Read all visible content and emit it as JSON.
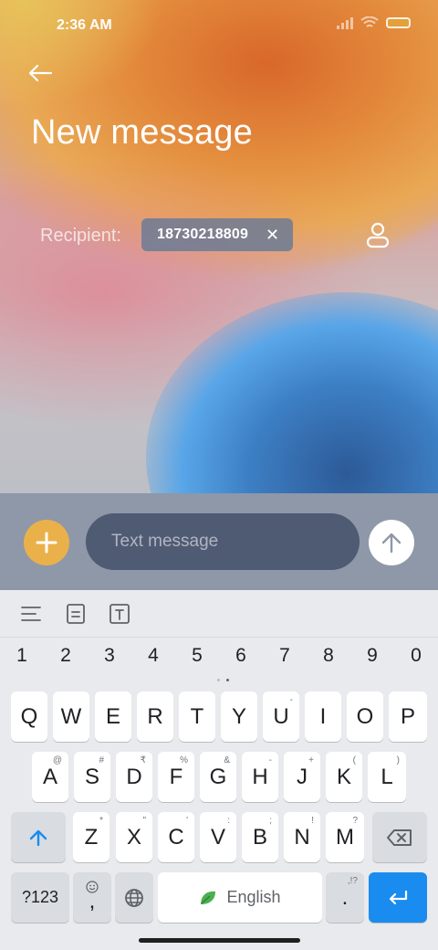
{
  "status_bar": {
    "time": "2:36 AM",
    "icons": [
      "signal-icon",
      "wifi-icon",
      "battery-icon"
    ],
    "battery_color": "#e4a03a"
  },
  "header": {
    "back_icon": "back-arrow-icon",
    "title": "New message"
  },
  "recipient": {
    "label": "Recipient:",
    "chips": [
      {
        "number": "18730218809",
        "remove_icon": "close-icon"
      }
    ],
    "contact_icon": "contact-person-icon"
  },
  "compose": {
    "attach_icon": "plus-icon",
    "placeholder": "Text message",
    "value": "",
    "send_icon": "send-arrow-icon",
    "attach_color": "#eab14a",
    "input_color": "#4f5a73"
  },
  "keyboard": {
    "toolbar_icons": [
      "align-icon",
      "clipboard-icon",
      "text-format-icon"
    ],
    "numbers": [
      "1",
      "2",
      "3",
      "4",
      "5",
      "6",
      "7",
      "8",
      "9",
      "0"
    ],
    "row1": [
      "Q",
      "W",
      "E",
      "R",
      "T",
      "Y",
      "U",
      "I",
      "O",
      "P"
    ],
    "row2": [
      {
        "key": "A",
        "hint": "@"
      },
      {
        "key": "S",
        "hint": "#"
      },
      {
        "key": "D",
        "hint": "₹"
      },
      {
        "key": "F",
        "hint": "%"
      },
      {
        "key": "G",
        "hint": "&"
      },
      {
        "key": "H",
        "hint": "-"
      },
      {
        "key": "J",
        "hint": "+"
      },
      {
        "key": "K",
        "hint": "("
      },
      {
        "key": "L",
        "hint": ")"
      }
    ],
    "row1_hints": [
      "",
      "",
      "",
      "",
      "",
      "",
      "-",
      "",
      "",
      ""
    ],
    "row3": [
      {
        "key": "Z",
        "hint": "*"
      },
      {
        "key": "X",
        "hint": "\""
      },
      {
        "key": "C",
        "hint": "'"
      },
      {
        "key": "V",
        "hint": ":"
      },
      {
        "key": "B",
        "hint": ";"
      },
      {
        "key": "N",
        "hint": "!"
      },
      {
        "key": "M",
        "hint": "?"
      }
    ],
    "shift_icon": "shift-arrow-icon",
    "backspace_icon": "backspace-icon",
    "symbols_label": "?123",
    "comma_label": ",",
    "emoji_icon": "emoji-icon",
    "globe_icon": "globe-icon",
    "space_label": "English",
    "space_icon": "leaf-icon",
    "period_label": ".",
    "period_hint": ",!?",
    "enter_icon": "enter-arrow-icon",
    "enter_color": "#1a8cf0"
  }
}
